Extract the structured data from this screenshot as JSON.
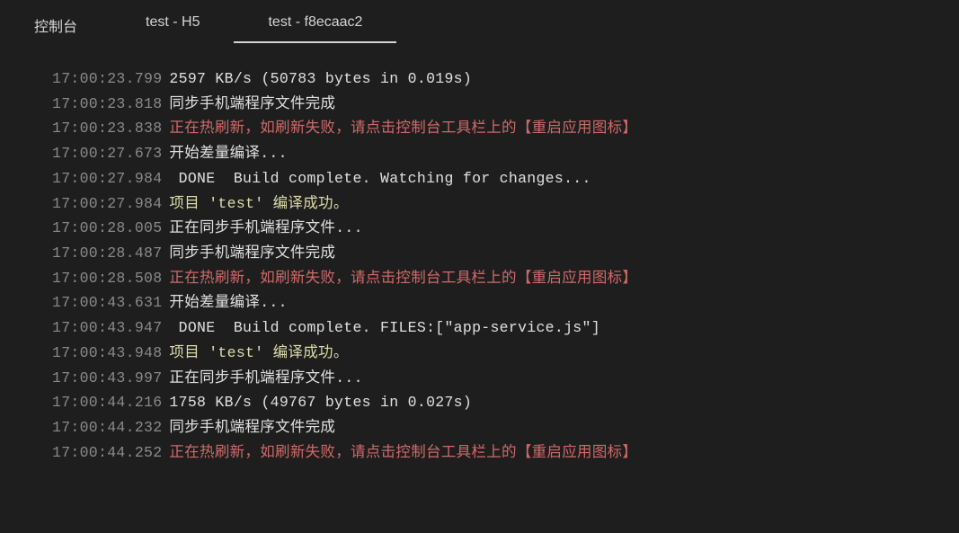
{
  "tabs": [
    {
      "label": "控制台",
      "active": false
    },
    {
      "label": "test - H5",
      "active": false
    },
    {
      "label": "test - f8ecaac2",
      "active": true
    }
  ],
  "logs": [
    {
      "ts": "17:00:23.799",
      "msg": "2597 KB/s (50783 bytes in 0.019s)",
      "type": "white"
    },
    {
      "ts": "17:00:23.818",
      "msg": "同步手机端程序文件完成",
      "type": "white"
    },
    {
      "ts": "17:00:23.838",
      "msg": "正在热刷新，如刷新失败，请点击控制台工具栏上的【重启应用图标】",
      "type": "red"
    },
    {
      "ts": "17:00:27.673",
      "msg": "开始差量编译...",
      "type": "white"
    },
    {
      "ts": "17:00:27.984",
      "msg": " DONE  Build complete. Watching for changes...",
      "type": "done"
    },
    {
      "ts": "17:00:27.984",
      "msg": "项目 'test' 编译成功。",
      "type": "yellow"
    },
    {
      "ts": "17:00:28.005",
      "msg": "正在同步手机端程序文件...",
      "type": "white"
    },
    {
      "ts": "17:00:28.487",
      "msg": "同步手机端程序文件完成",
      "type": "white"
    },
    {
      "ts": "17:00:28.508",
      "msg": "正在热刷新，如刷新失败，请点击控制台工具栏上的【重启应用图标】",
      "type": "red"
    },
    {
      "ts": "17:00:43.631",
      "msg": "开始差量编译...",
      "type": "white"
    },
    {
      "ts": "17:00:43.947",
      "msg": " DONE  Build complete. FILES:[\"app-service.js\"]",
      "type": "done"
    },
    {
      "ts": "17:00:43.948",
      "msg": "项目 'test' 编译成功。",
      "type": "yellow"
    },
    {
      "ts": "17:00:43.997",
      "msg": "正在同步手机端程序文件...",
      "type": "white"
    },
    {
      "ts": "17:00:44.216",
      "msg": "1758 KB/s (49767 bytes in 0.027s)",
      "type": "white"
    },
    {
      "ts": "17:00:44.232",
      "msg": "同步手机端程序文件完成",
      "type": "white"
    },
    {
      "ts": "17:00:44.252",
      "msg": "正在热刷新，如刷新失败，请点击控制台工具栏上的【重启应用图标】",
      "type": "red"
    }
  ]
}
